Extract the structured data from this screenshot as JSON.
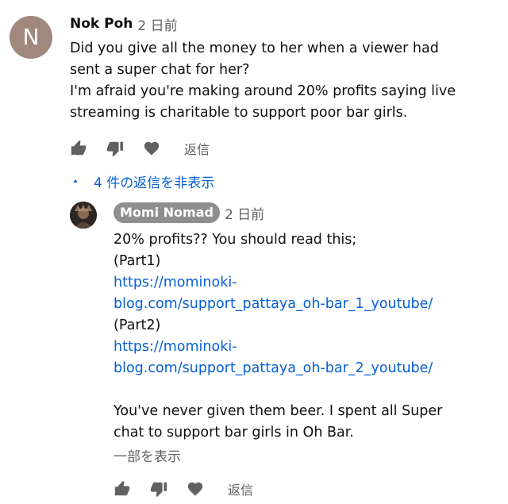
{
  "top_comment": {
    "avatar_letter": "N",
    "avatar_color": "#a1887f",
    "author": "Nok Poh",
    "time": "2 日前",
    "lines": [
      "Did you give all the money to her when a viewer had",
      "sent a super chat for her?",
      "I'm afraid you're making around 20% profits saying live",
      "streaming is charitable to support poor bar girls."
    ],
    "reply_label": "返信"
  },
  "replies_toggle": {
    "label": "4 件の返信を非表示",
    "color": "#065fd4"
  },
  "reply": {
    "author": "Momi Nomad",
    "time": "2 日前",
    "line1": "20% profits?? You should read this;",
    "line2": "(Part1)",
    "link1_line1": "https://mominoki-",
    "link1_line2": "blog.com/support_pattaya_oh-bar_1_youtube/",
    "line3": "(Part2)",
    "link2_line1": "https://mominoki-",
    "link2_line2": "blog.com/support_pattaya_oh-bar_2_youtube/",
    "line4": "You've never given them beer. I spent all Super",
    "line5": "chat to support bar girls in Oh Bar.",
    "read_more": "一部を表示",
    "reply_label": "返信"
  },
  "icons": {
    "like": "thumbs-up-icon",
    "dislike": "thumbs-down-icon",
    "heart": "heart-icon",
    "collapse": "caret-up-icon"
  }
}
